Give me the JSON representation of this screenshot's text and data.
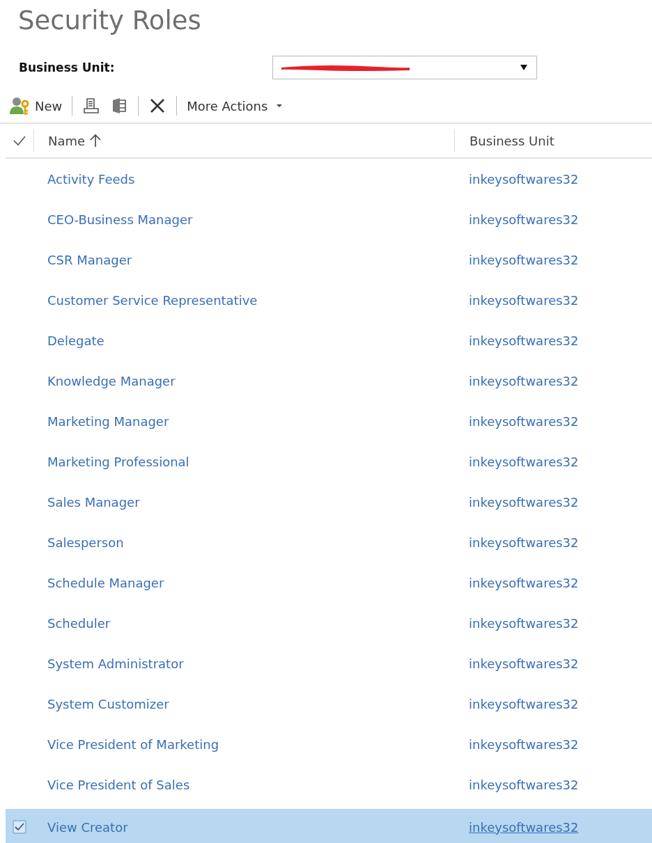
{
  "page": {
    "title": "Security Roles"
  },
  "filter": {
    "label": "Business Unit:",
    "redacted": true
  },
  "toolbar": {
    "new_label": "New",
    "more_label": "More Actions"
  },
  "table": {
    "columns": [
      "Name",
      "Business Unit"
    ],
    "rows": [
      {
        "name": "Activity Feeds",
        "unit": "inkeysoftwares32",
        "selected": false
      },
      {
        "name": "CEO-Business Manager",
        "unit": "inkeysoftwares32",
        "selected": false
      },
      {
        "name": "CSR Manager",
        "unit": "inkeysoftwares32",
        "selected": false
      },
      {
        "name": "Customer Service Representative",
        "unit": "inkeysoftwares32",
        "selected": false
      },
      {
        "name": "Delegate",
        "unit": "inkeysoftwares32",
        "selected": false
      },
      {
        "name": "Knowledge Manager",
        "unit": "inkeysoftwares32",
        "selected": false
      },
      {
        "name": "Marketing Manager",
        "unit": "inkeysoftwares32",
        "selected": false
      },
      {
        "name": "Marketing Professional",
        "unit": "inkeysoftwares32",
        "selected": false
      },
      {
        "name": "Sales Manager",
        "unit": "inkeysoftwares32",
        "selected": false
      },
      {
        "name": "Salesperson",
        "unit": "inkeysoftwares32",
        "selected": false
      },
      {
        "name": "Schedule Manager",
        "unit": "inkeysoftwares32",
        "selected": false
      },
      {
        "name": "Scheduler",
        "unit": "inkeysoftwares32",
        "selected": false
      },
      {
        "name": "System Administrator",
        "unit": "inkeysoftwares32",
        "selected": false
      },
      {
        "name": "System Customizer",
        "unit": "inkeysoftwares32",
        "selected": false
      },
      {
        "name": "Vice President of Marketing",
        "unit": "inkeysoftwares32",
        "selected": false
      },
      {
        "name": "Vice President of Sales",
        "unit": "inkeysoftwares32",
        "selected": false
      },
      {
        "name": "View Creator",
        "unit": "inkeysoftwares32",
        "selected": true
      }
    ]
  }
}
